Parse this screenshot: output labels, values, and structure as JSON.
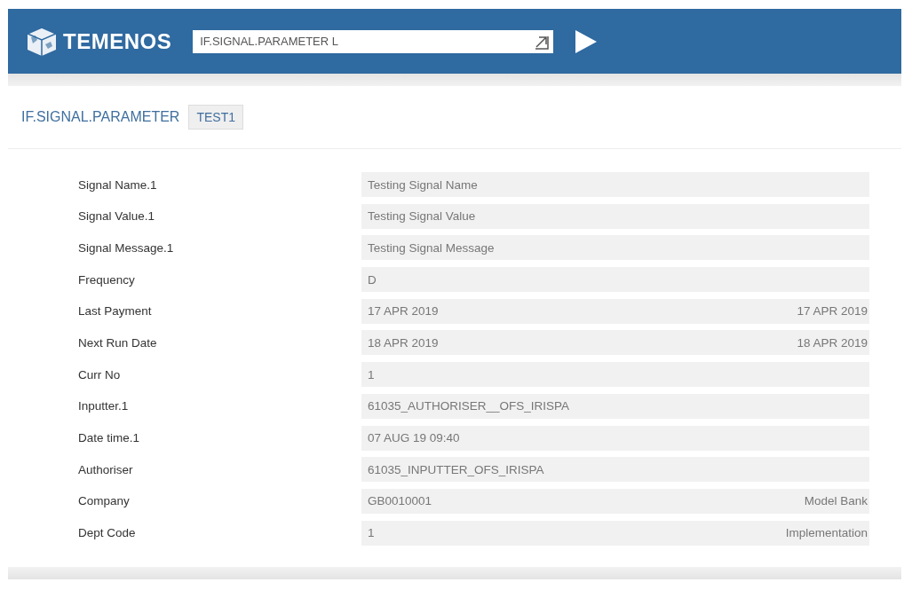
{
  "header": {
    "brand": "TEMENOS",
    "command": {
      "value": "IF.SIGNAL.PARAMETER L"
    }
  },
  "record": {
    "application": "IF.SIGNAL.PARAMETER",
    "id": "TEST1"
  },
  "fields": [
    {
      "label": "Signal Name.1",
      "value": "Testing Signal Name"
    },
    {
      "label": "Signal Value.1",
      "value": "Testing Signal Value"
    },
    {
      "label": "Signal Message.1",
      "value": "Testing Signal Message"
    },
    {
      "label": "Frequency",
      "value": "D"
    },
    {
      "label": "Last Payment",
      "value": "17 APR 2019",
      "enrichment": "17 APR 2019"
    },
    {
      "label": "Next Run Date",
      "value": "18 APR 2019",
      "enrichment": "18 APR 2019"
    },
    {
      "label": "Curr No",
      "value": "1"
    },
    {
      "label": "Inputter.1",
      "value": "61035_AUTHORISER__OFS_IRISPA"
    },
    {
      "label": "Date time.1",
      "value": "07 AUG 19 09:40"
    },
    {
      "label": "Authoriser",
      "value": "61035_INPUTTER_OFS_IRISPA"
    },
    {
      "label": "Company",
      "value": "GB0010001",
      "enrichment": "Model Bank"
    },
    {
      "label": "Dept Code",
      "value": "1",
      "enrichment": "Implementation"
    }
  ]
}
